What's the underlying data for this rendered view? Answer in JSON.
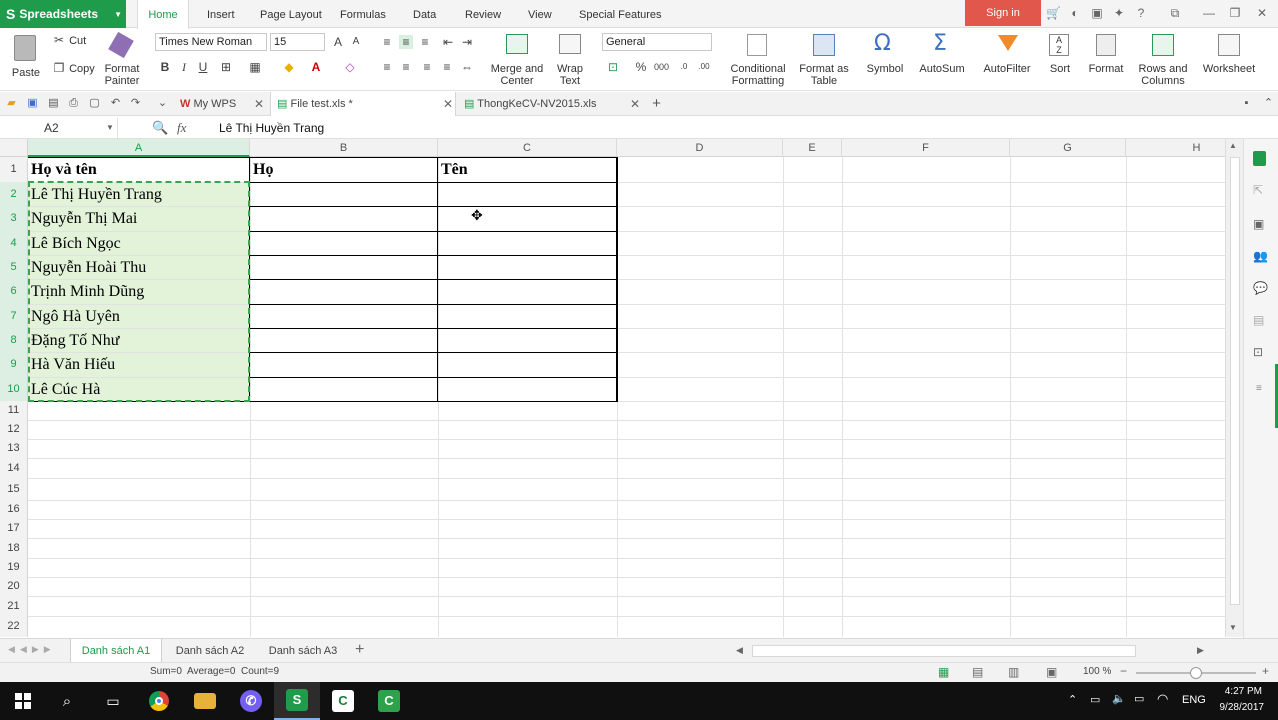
{
  "app": {
    "name": "Spreadsheets",
    "accent": "#1e9b4b"
  },
  "menu": [
    "Home",
    "Insert",
    "Page Layout",
    "Formulas",
    "Data",
    "Review",
    "View",
    "Special Features"
  ],
  "signin": "Sign in",
  "ribbon": {
    "paste": "Paste",
    "cut": "Cut",
    "copy": "Copy",
    "format_painter_1": "Format",
    "format_painter_2": "Painter",
    "font_name": "Times New Roman",
    "font_size": "15",
    "merge_1": "Merge and",
    "merge_2": "Center",
    "wrap_1": "Wrap",
    "wrap_2": "Text",
    "number_format": "General",
    "percent": "%",
    "cond_1": "Conditional",
    "cond_2": "Formatting",
    "fmt_table_1": "Format as",
    "fmt_table_2": "Table",
    "symbol": "Symbol",
    "autosum": "AutoSum",
    "autofilter": "AutoFilter",
    "sort": "Sort",
    "format": "Format",
    "rows_cols_1": "Rows and",
    "rows_cols_2": "Columns",
    "worksheet": "Worksheet"
  },
  "tabs": [
    {
      "label": "My WPS"
    },
    {
      "label": "File test.xls *"
    },
    {
      "label": "ThongKeCV-NV2015.xls"
    }
  ],
  "formula_bar": {
    "cell_ref": "A2",
    "fx": "fx",
    "value": "Lê Thị Huyền Trang"
  },
  "columns": [
    "A",
    "B",
    "C",
    "D",
    "E",
    "F",
    "G",
    "H"
  ],
  "rows": [
    "1",
    "2",
    "3",
    "4",
    "5",
    "6",
    "7",
    "8",
    "9",
    "10",
    "11",
    "12",
    "13",
    "14",
    "15",
    "16",
    "17",
    "18",
    "19",
    "20",
    "21",
    "22"
  ],
  "table": {
    "headers": [
      "Họ và tên",
      "Họ",
      "Tên"
    ],
    "names": [
      "Lê Thị Huyền Trang",
      "Nguyễn Thị Mai",
      "Lê Bích Ngọc",
      "Nguyễn Hoài Thu",
      "Trịnh Minh Dũng",
      "Ngô Hà Uyên",
      "Đặng Tố Như",
      "Hà Văn Hiếu",
      "Lê Cúc Hà"
    ]
  },
  "sheets": [
    "Danh sách A1",
    "Danh sách A2",
    "Danh sách A3"
  ],
  "status": {
    "summary": "Sum=0  Average=0  Count=9",
    "zoom": "100 %"
  },
  "taskbar": {
    "lang": "ENG",
    "time": "4:27 PM",
    "date": "9/28/2017"
  }
}
